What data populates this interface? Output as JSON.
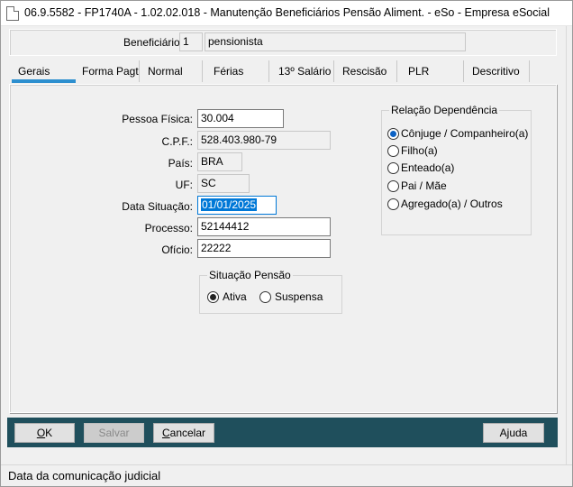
{
  "window": {
    "title": "06.9.5582 - FP1740A - 1.02.02.018 - Manutenção Beneficiários Pensão Aliment. - eSo - Empresa eSocial"
  },
  "header": {
    "beneficiario_label": "Beneficiário:",
    "beneficiario_code": "1",
    "beneficiario_name": "pensionista"
  },
  "tabs": [
    {
      "label": "Gerais",
      "active": true
    },
    {
      "label": "Forma Pagt"
    },
    {
      "label": "Normal"
    },
    {
      "label": "Férias"
    },
    {
      "label": "13º Salário"
    },
    {
      "label": "Rescisão"
    },
    {
      "label": "PLR"
    },
    {
      "label": "Descritivo"
    }
  ],
  "form": {
    "pessoa_fisica": {
      "label": "Pessoa Física:",
      "value": "30.004"
    },
    "cpf": {
      "label": "C.P.F.:",
      "value": "528.403.980-79"
    },
    "pais": {
      "label": "País:",
      "value": "BRA"
    },
    "uf": {
      "label": "UF:",
      "value": "SC"
    },
    "data_situacao": {
      "label": "Data Situação:",
      "value": "01/01/2025"
    },
    "processo": {
      "label": "Processo:",
      "value": "52144412"
    },
    "oficio": {
      "label": "Ofício:",
      "value": "22222"
    }
  },
  "situacao_pensao": {
    "title": "Situação Pensão",
    "options": [
      "Ativa",
      "Suspensa"
    ],
    "selected": "Ativa"
  },
  "relacao_dependencia": {
    "title": "Relação Dependência",
    "options": [
      "Cônjuge / Companheiro(a)",
      "Filho(a)",
      "Enteado(a)",
      "Pai / Mãe",
      "Agregado(a) / Outros"
    ],
    "selected": "Cônjuge / Companheiro(a)"
  },
  "buttons": {
    "ok_u": "O",
    "ok_rest": "K",
    "salvar": "Salvar",
    "cancelar_u": "C",
    "cancelar_rest": "ancelar",
    "ajuda_pre": "A",
    "ajuda_u": "j",
    "ajuda_rest": "uda"
  },
  "status": {
    "text": "Data da comunicação judicial"
  },
  "colors": {
    "accent": "#2d8fcf",
    "bottom_bar": "#1f4f5c",
    "selection": "#0078d7"
  }
}
